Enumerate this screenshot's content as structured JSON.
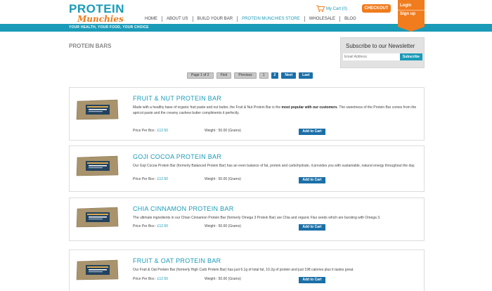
{
  "header": {
    "logo_top": "PROTEIN",
    "logo_bottom": "Munchies",
    "cart_label": "My Cart (0)",
    "checkout_label": "CHECKOUT",
    "login_label": "Login",
    "signup_label": "Sign up",
    "tagline": "YOUR HEALTH, YOUR FOOD, YOUR CHOICE",
    "nav": [
      "HOME",
      "ABOUT US",
      "BUILD YOUR BAR",
      "PROTEIN MUNCHIES STORE",
      "WHOLESALE",
      "BLOG"
    ],
    "active_nav": "PROTEIN MUNCHIES STORE"
  },
  "page_title": "PROTEIN BARS",
  "newsletter": {
    "title": "Subscribe to our Newsletter",
    "placeholder": "Email Address",
    "button": "Subscribe"
  },
  "pagination": {
    "info": "Page 1 of 2",
    "first": "First",
    "previous": "Previous",
    "page1": "1",
    "page2": "2",
    "next": "Next",
    "last": "Last"
  },
  "products": [
    {
      "name": "FRUIT & NUT PROTEIN BAR",
      "desc_before": "Made with a healthy base of organic fruit paste and nut butter, the Fruit & Nut Protein Bar is the ",
      "desc_bold": "most popular with our customers",
      "desc_after": ". The sweetness of the Protein Bar comes from the apricot paste and the creamy cashew butter compliments it perfectly.",
      "price_label": "Price Per Box : ",
      "price": "£12.50",
      "weight": "Weight : 50.00 (Grams)",
      "button": "Add to Cart"
    },
    {
      "name": "GOJI COCOA PROTEIN BAR",
      "desc_before": "Our Goji Cocoa Protein Bar (formerly Balanced Protein Bar) has an even balance of fat, protein and carbohydrate, it provides you with sustainable, natural energy throughout the day.",
      "desc_bold": "",
      "desc_after": "",
      "price_label": "Price Per Box : ",
      "price": "£12.50",
      "weight": "Weight : 50.00 (Grams)",
      "button": "Add to Cart"
    },
    {
      "name": "CHIA CINNAMON PROTEIN BAR",
      "desc_before": "The ultimate ingredients in our Chian Cinnamon Protein Bar (formerly Omega 3 Protein Bar) are Chia and organic Flax seeds which are bursting with Omega 3.",
      "desc_bold": "",
      "desc_after": "",
      "price_label": "Price Per Box : ",
      "price": "£12.50",
      "weight": "Weight : 50.00 (Grams)",
      "button": "Add to Cart"
    },
    {
      "name": "FRUIT & OAT PROTEIN BAR",
      "desc_before": "Our Fruit & Oat Protein Bar (formerly High Carb Protein Bar) has just 6.1g of total fat, 10.2g of protein and just 198 calories plus it tastes great.",
      "desc_bold": "",
      "desc_after": "",
      "price_label": "Price Per Box : ",
      "price": "£12.50",
      "weight": "Weight : 50.00 (Grams)",
      "button": "Add to Cart"
    }
  ],
  "colors": {
    "brand_blue": "#1a9bb8",
    "brand_orange": "#f07c1e",
    "button_blue": "#1a6fa8"
  }
}
